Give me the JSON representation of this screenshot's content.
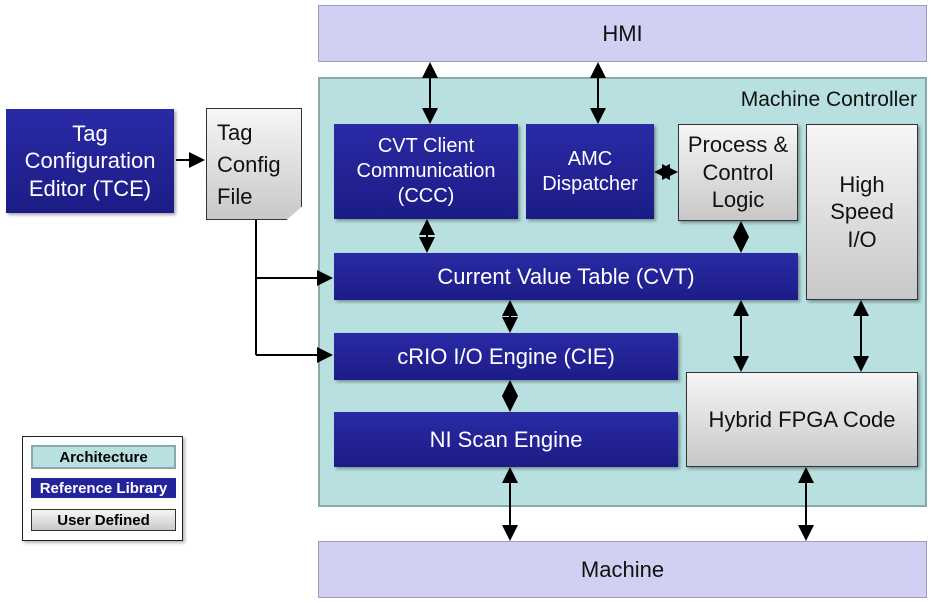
{
  "colors": {
    "architecture": "#b8e0e0",
    "reference_library": "#23239a",
    "user_defined": "#d8d8d8",
    "external": "#d2d0f2"
  },
  "blocks": {
    "hmi": "HMI",
    "machine": "Machine",
    "machine_controller": "Machine Controller",
    "tce": "Tag\nConfiguration\nEditor (TCE)",
    "tag_config_file": "Tag\nConfig\nFile",
    "ccc": "CVT Client\nCommunication\n(CCC)",
    "amc": "AMC\nDispatcher",
    "process": "Process &\nControl\nLogic",
    "high_speed_io": "High\nSpeed\nI/O",
    "cvt": "Current Value Table (CVT)",
    "cie": "cRIO I/O Engine (CIE)",
    "scan": "NI Scan Engine",
    "fpga": "Hybrid FPGA Code"
  },
  "legend": {
    "architecture": "Architecture",
    "reference_library": "Reference Library",
    "user_defined": "User Defined"
  }
}
